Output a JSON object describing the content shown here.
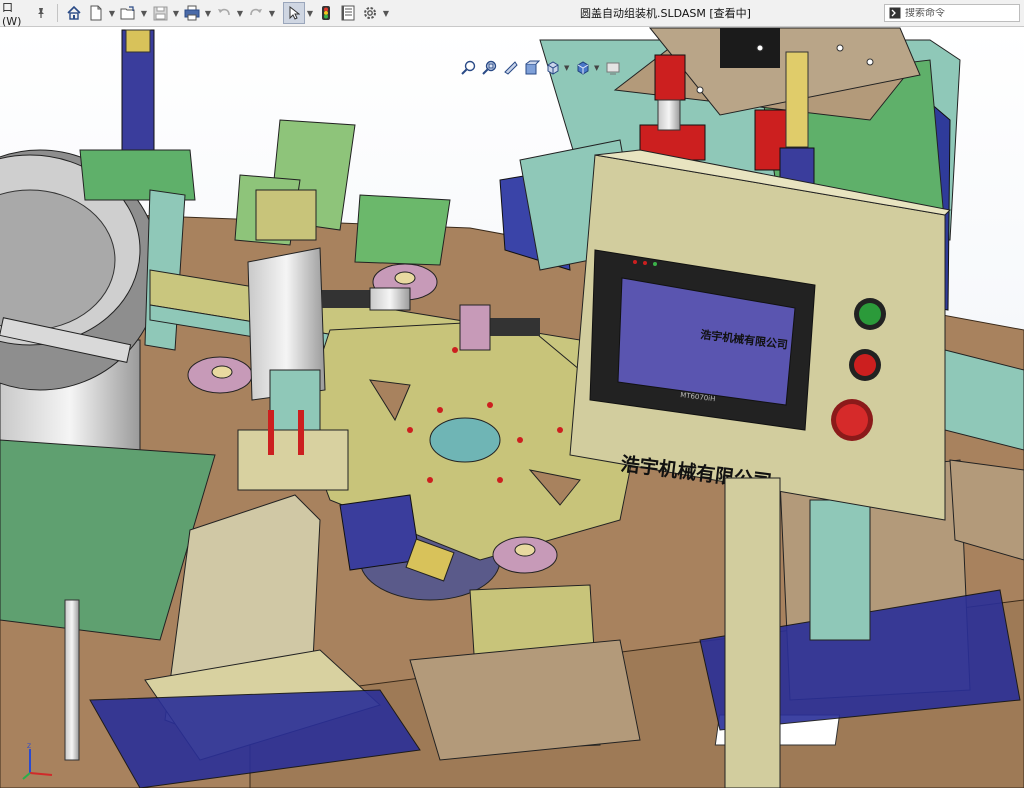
{
  "toolbar": {
    "window_menu_label": "口(W)",
    "icons": [
      "pin-icon",
      "home-icon",
      "new-document-icon",
      "open-folder-icon",
      "save-icon",
      "print-icon",
      "undo-icon",
      "redo-icon",
      "select-arrow-icon",
      "traffic-light-icon",
      "file-properties-icon",
      "gear-icon"
    ]
  },
  "title": "圆盖自动组装机.SLDASM [查看中]",
  "search": {
    "placeholder": "搜索命令"
  },
  "heads_up_view": {
    "icons": [
      "zoom-to-fit-icon",
      "zoom-to-area-icon",
      "previous-view-icon",
      "section-view-icon",
      "view-orientation-icon",
      "display-style-icon",
      "hide-show-items-icon"
    ]
  },
  "model": {
    "hmi_screen_text": "浩宇机械有限公司",
    "hmi_model_text": "MT6070iH",
    "panel_label": "浩宇机械有限公司"
  },
  "colors": {
    "table": "#a8825e",
    "plate_yellow": "#c8c47a",
    "hmi_box": "#d2cd9e",
    "green_part": "#6bb86b",
    "blue_part": "#2e2f9c",
    "screen": "#5a55b0",
    "red_part": "#cc1f1f",
    "teal_part": "#8fc8b8",
    "pink_part": "#c79ab8"
  }
}
